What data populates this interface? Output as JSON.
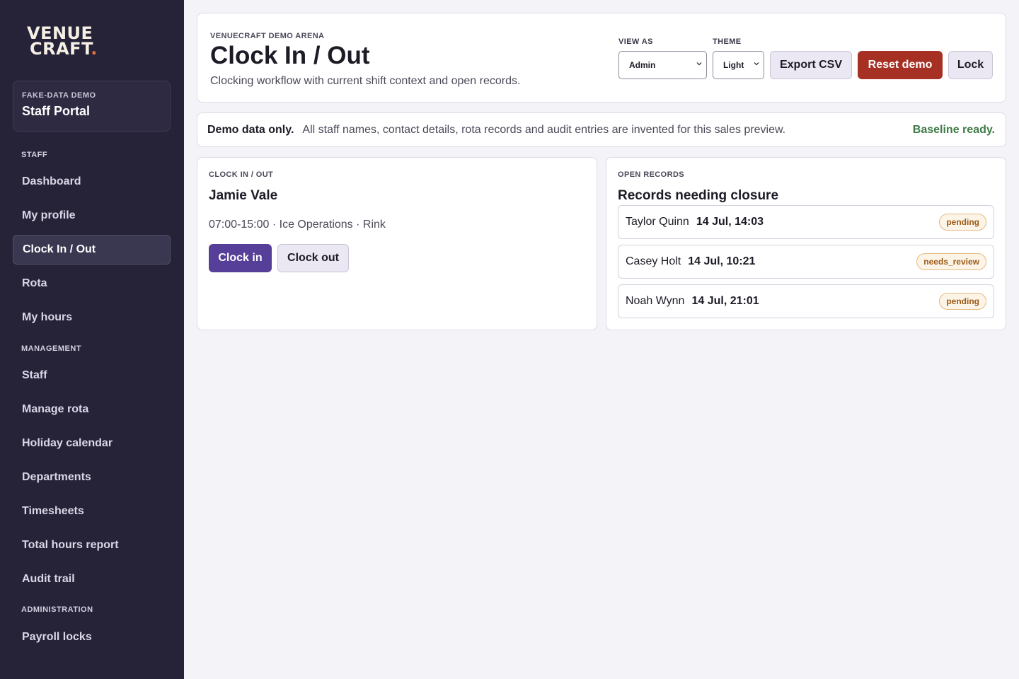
{
  "brand": {
    "logo_line1": "VENUE",
    "logo_line2": "CRAFT",
    "logo_dot": ".",
    "accent_color": "#e8743b"
  },
  "sidebar": {
    "portal_kicker": "FAKE-DATA DEMO",
    "portal_title": "Staff Portal",
    "sections": [
      {
        "label": "STAFF",
        "items": [
          "Dashboard",
          "My profile",
          "Clock In / Out",
          "Rota",
          "My hours"
        ]
      },
      {
        "label": "MANAGEMENT",
        "items": [
          "Staff",
          "Manage rota",
          "Holiday calendar",
          "Departments",
          "Timesheets",
          "Total hours report",
          "Audit trail"
        ]
      },
      {
        "label": "ADMINISTRATION",
        "items": [
          "Payroll locks"
        ]
      }
    ],
    "active_item": "Clock In / Out"
  },
  "header": {
    "eyebrow": "VENUECRAFT DEMO ARENA",
    "title": "Clock In / Out",
    "subtitle": "Clocking workflow with current shift context and open records.",
    "view_as_label": "VIEW AS",
    "view_as_value": "Admin",
    "theme_label": "THEME",
    "theme_value": "Light",
    "export_label": "Export CSV",
    "reset_label": "Reset demo",
    "lock_label": "Lock"
  },
  "banner": {
    "strong": "Demo data only.",
    "text": "All staff names, contact details, rota records and audit entries are invented for this sales preview.",
    "status": "Baseline ready.",
    "status_color": "#3d7a45"
  },
  "clock_panel": {
    "kicker": "CLOCK IN / OUT",
    "employee": "Jamie Vale",
    "shift": "07:00-15:00 · Ice Operations · Rink",
    "clock_in_label": "Clock in",
    "clock_out_label": "Clock out"
  },
  "records_panel": {
    "kicker": "OPEN RECORDS",
    "title": "Records needing closure",
    "records": [
      {
        "name": "Taylor Quinn",
        "time": "14 Jul, 14:03",
        "status": "pending"
      },
      {
        "name": "Casey Holt",
        "time": "14 Jul, 10:21",
        "status": "needs_review"
      },
      {
        "name": "Noah Wynn",
        "time": "14 Jul, 21:01",
        "status": "pending"
      }
    ]
  },
  "colors": {
    "sidebar_bg": "#262339",
    "primary": "#563f99",
    "danger": "#a63024"
  }
}
